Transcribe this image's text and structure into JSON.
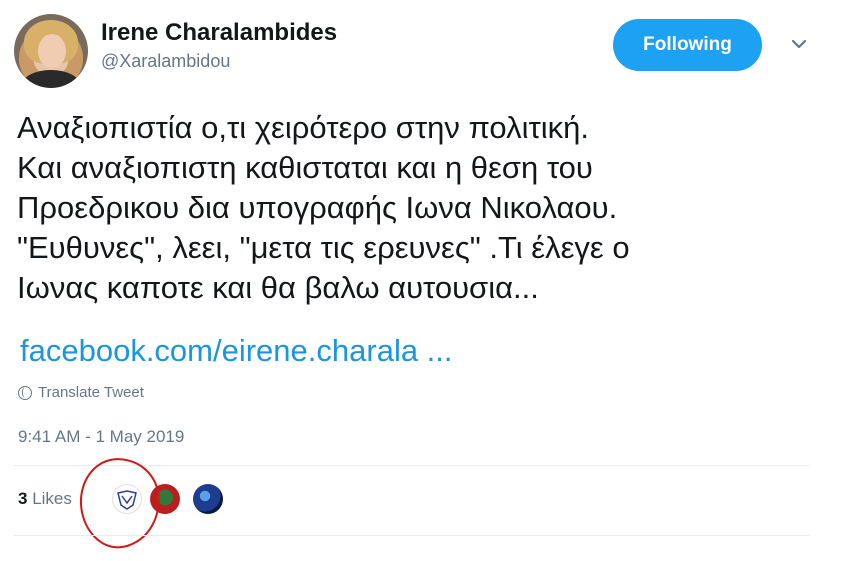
{
  "tweet": {
    "author_name": "Irene Charalambides",
    "author_handle": "@Xaralambidou",
    "follow_label": "Following",
    "text": "Αναξιοπιστία ο,τι χειρότερο στην πολιτική.\nΚαι αναξιοπιστη καθισταται και η θεση του\nΠροεδρικου δια υπογραφής Ιωνα Νικολαου.\n\"Ευθυνες\", λεει, \"μετα τις ερευνες\" .Τι έλεγε ο\nΙωνας καποτε και θα βαλω αυτουσια...",
    "link_text": "facebook.com/eirene.charala ...",
    "translate_label": "Translate Tweet",
    "timestamp": "9:41 AM - 1 May 2019",
    "likes_count": "3",
    "likes_label": "Likes"
  },
  "icons": {
    "chevron": "chevron-down-icon",
    "translate": "globe-icon"
  },
  "colors": {
    "accent": "#1da1f2",
    "link": "#1b95e0",
    "secondary_text": "#657786",
    "annotation": "#d01818"
  }
}
